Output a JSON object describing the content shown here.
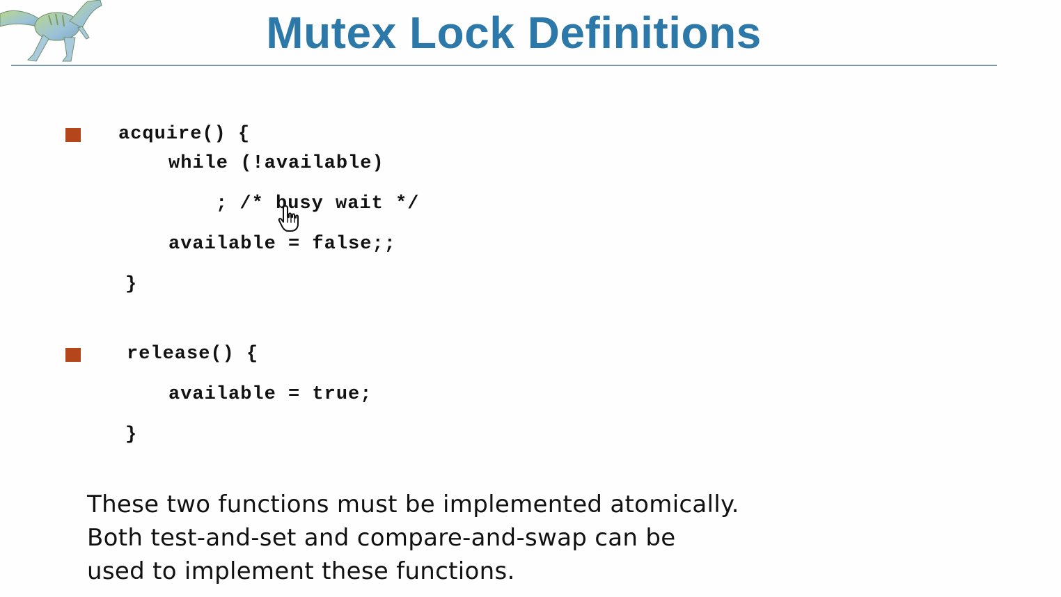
{
  "slide": {
    "title": "Mutex Lock Definitions",
    "code": {
      "acquire": [
        "acquire() {",
        "while (!available)",
        "; /* busy wait */",
        "available = false;;",
        "}"
      ],
      "release": [
        "release() {",
        "available = true;",
        "}"
      ]
    },
    "note_lines": [
      "These two functions must be implemented atomically.",
      "Both test-and-set and compare-and-swap can be",
      "used to implement these functions."
    ]
  },
  "icons": {
    "logo": "dinosaur-logo",
    "bullet": "square-bullet",
    "cursor": "hand-pointer-cursor"
  },
  "colors": {
    "title": "#2c78a8",
    "rule": "#7a98ad",
    "bullet": "#b5461b",
    "text": "#111111",
    "background": "#fefefe"
  }
}
